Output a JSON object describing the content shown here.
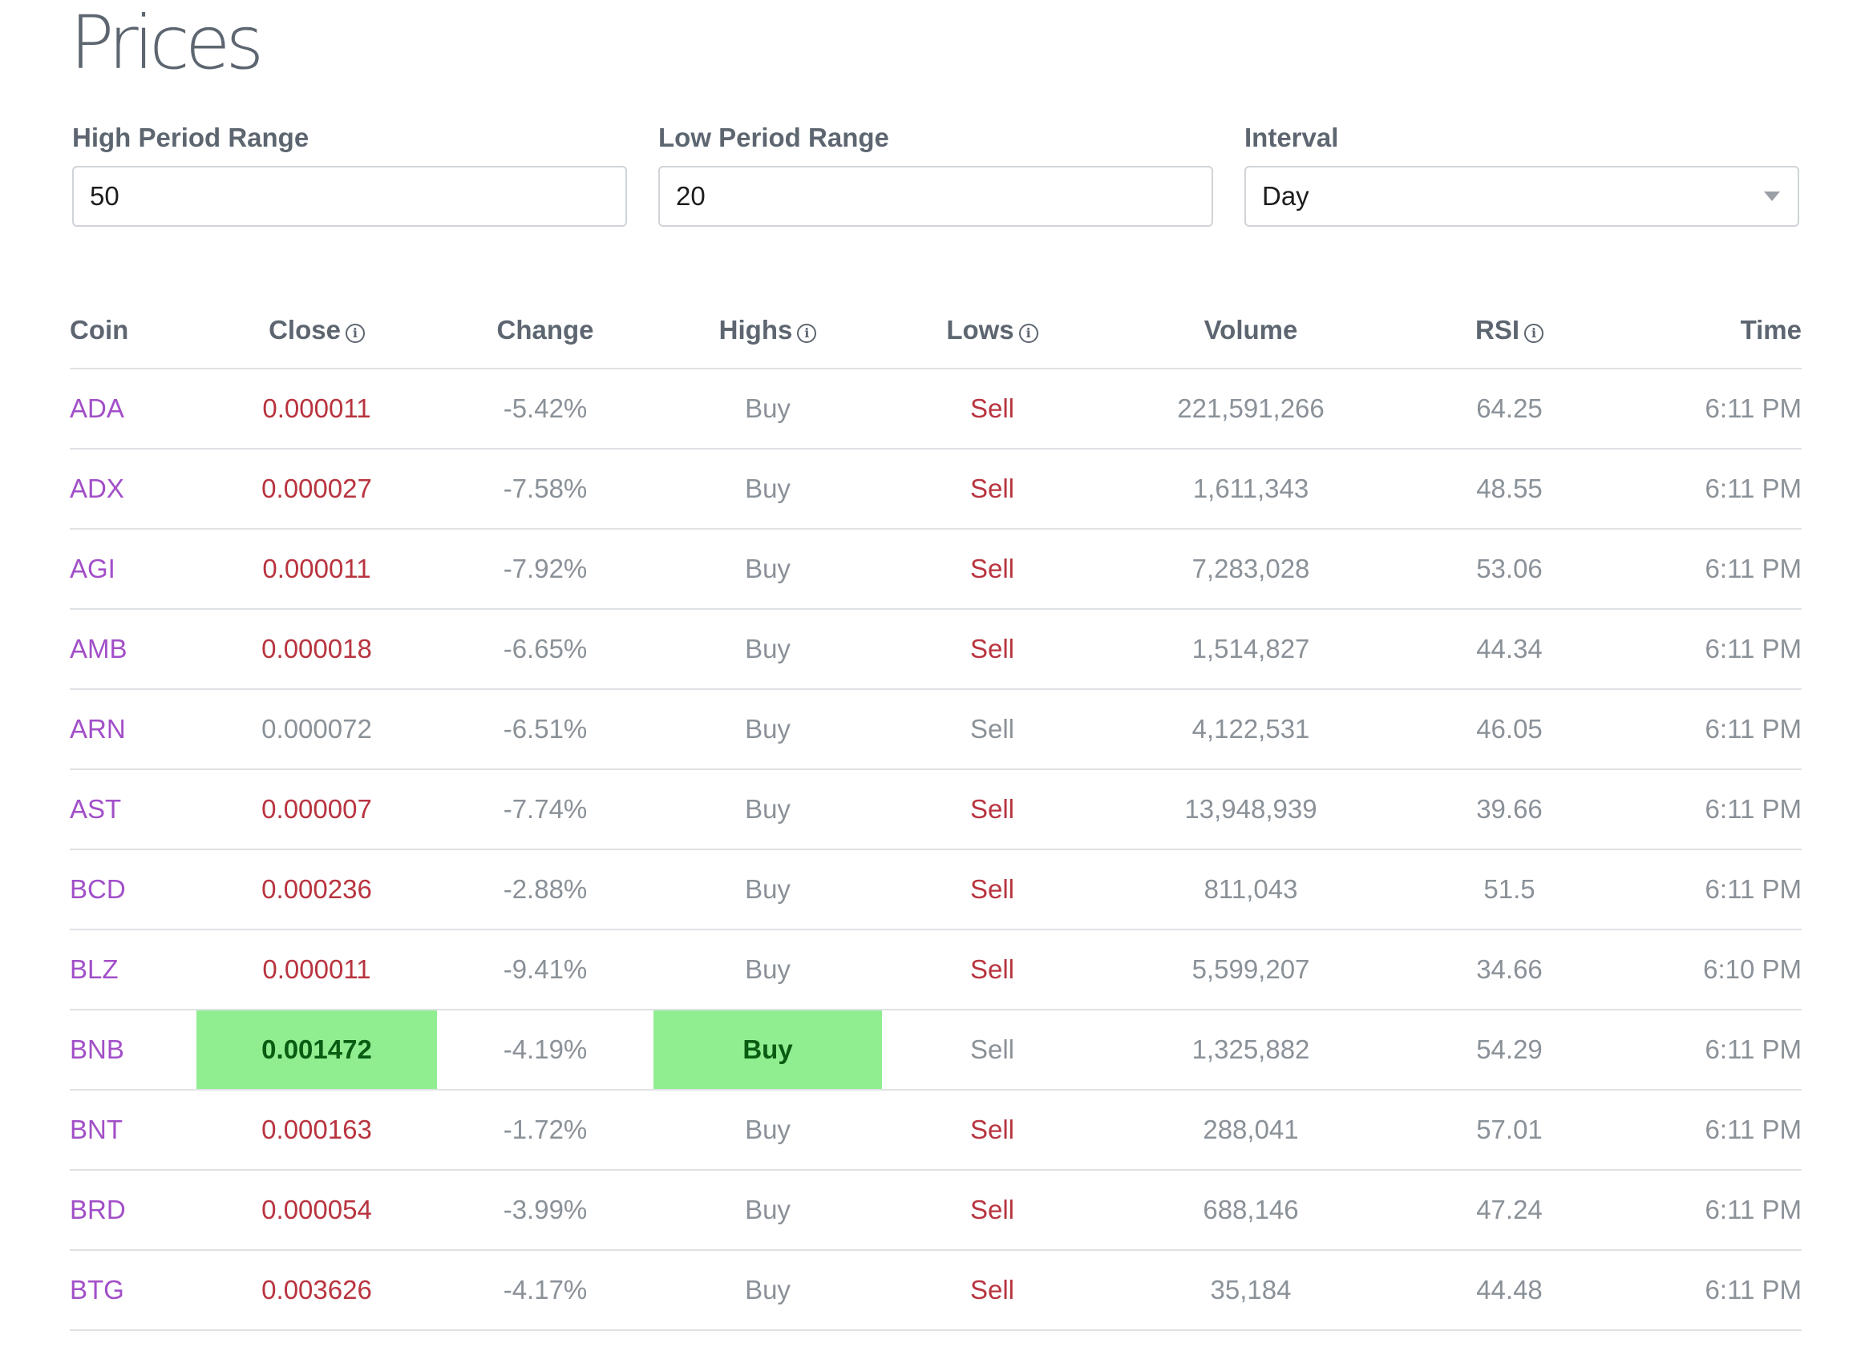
{
  "page": {
    "title": "Prices"
  },
  "filters": {
    "high_period": {
      "label": "High Period Range",
      "value": "50"
    },
    "low_period": {
      "label": "Low Period Range",
      "value": "20"
    },
    "interval": {
      "label": "Interval",
      "value": "Day"
    }
  },
  "table": {
    "headers": {
      "coin": "Coin",
      "close": "Close",
      "change": "Change",
      "highs": "Highs",
      "lows": "Lows",
      "volume": "Volume",
      "rsi": "RSI",
      "time": "Time"
    },
    "info_icon_glyph": "i",
    "rows": [
      {
        "coin": "ADA",
        "close": "0.000011",
        "change": "-5.42%",
        "highs": "Buy",
        "lows": "Sell",
        "volume": "221,591,266",
        "rsi": "64.25",
        "time": "6:11 PM",
        "close_status": "red",
        "lows_status": "red",
        "close_highlight": false,
        "highs_highlight": false
      },
      {
        "coin": "ADX",
        "close": "0.000027",
        "change": "-7.58%",
        "highs": "Buy",
        "lows": "Sell",
        "volume": "1,611,343",
        "rsi": "48.55",
        "time": "6:11 PM",
        "close_status": "red",
        "lows_status": "red",
        "close_highlight": false,
        "highs_highlight": false
      },
      {
        "coin": "AGI",
        "close": "0.000011",
        "change": "-7.92%",
        "highs": "Buy",
        "lows": "Sell",
        "volume": "7,283,028",
        "rsi": "53.06",
        "time": "6:11 PM",
        "close_status": "red",
        "lows_status": "red",
        "close_highlight": false,
        "highs_highlight": false
      },
      {
        "coin": "AMB",
        "close": "0.000018",
        "change": "-6.65%",
        "highs": "Buy",
        "lows": "Sell",
        "volume": "1,514,827",
        "rsi": "44.34",
        "time": "6:11 PM",
        "close_status": "red",
        "lows_status": "red",
        "close_highlight": false,
        "highs_highlight": false
      },
      {
        "coin": "ARN",
        "close": "0.000072",
        "change": "-6.51%",
        "highs": "Buy",
        "lows": "Sell",
        "volume": "4,122,531",
        "rsi": "46.05",
        "time": "6:11 PM",
        "close_status": "grey",
        "lows_status": "grey",
        "close_highlight": false,
        "highs_highlight": false
      },
      {
        "coin": "AST",
        "close": "0.000007",
        "change": "-7.74%",
        "highs": "Buy",
        "lows": "Sell",
        "volume": "13,948,939",
        "rsi": "39.66",
        "time": "6:11 PM",
        "close_status": "red",
        "lows_status": "red",
        "close_highlight": false,
        "highs_highlight": false
      },
      {
        "coin": "BCD",
        "close": "0.000236",
        "change": "-2.88%",
        "highs": "Buy",
        "lows": "Sell",
        "volume": "811,043",
        "rsi": "51.5",
        "time": "6:11 PM",
        "close_status": "red",
        "lows_status": "red",
        "close_highlight": false,
        "highs_highlight": false
      },
      {
        "coin": "BLZ",
        "close": "0.000011",
        "change": "-9.41%",
        "highs": "Buy",
        "lows": "Sell",
        "volume": "5,599,207",
        "rsi": "34.66",
        "time": "6:10 PM",
        "close_status": "red",
        "lows_status": "red",
        "close_highlight": false,
        "highs_highlight": false
      },
      {
        "coin": "BNB",
        "close": "0.001472",
        "change": "-4.19%",
        "highs": "Buy",
        "lows": "Sell",
        "volume": "1,325,882",
        "rsi": "54.29",
        "time": "6:11 PM",
        "close_status": "green",
        "lows_status": "grey",
        "close_highlight": true,
        "highs_highlight": true
      },
      {
        "coin": "BNT",
        "close": "0.000163",
        "change": "-1.72%",
        "highs": "Buy",
        "lows": "Sell",
        "volume": "288,041",
        "rsi": "57.01",
        "time": "6:11 PM",
        "close_status": "red",
        "lows_status": "red",
        "close_highlight": false,
        "highs_highlight": false
      },
      {
        "coin": "BRD",
        "close": "0.000054",
        "change": "-3.99%",
        "highs": "Buy",
        "lows": "Sell",
        "volume": "688,146",
        "rsi": "47.24",
        "time": "6:11 PM",
        "close_status": "red",
        "lows_status": "red",
        "close_highlight": false,
        "highs_highlight": false
      },
      {
        "coin": "BTG",
        "close": "0.003626",
        "change": "-4.17%",
        "highs": "Buy",
        "lows": "Sell",
        "volume": "35,184",
        "rsi": "44.48",
        "time": "6:11 PM",
        "close_status": "red",
        "lows_status": "red",
        "close_highlight": false,
        "highs_highlight": false
      }
    ]
  }
}
